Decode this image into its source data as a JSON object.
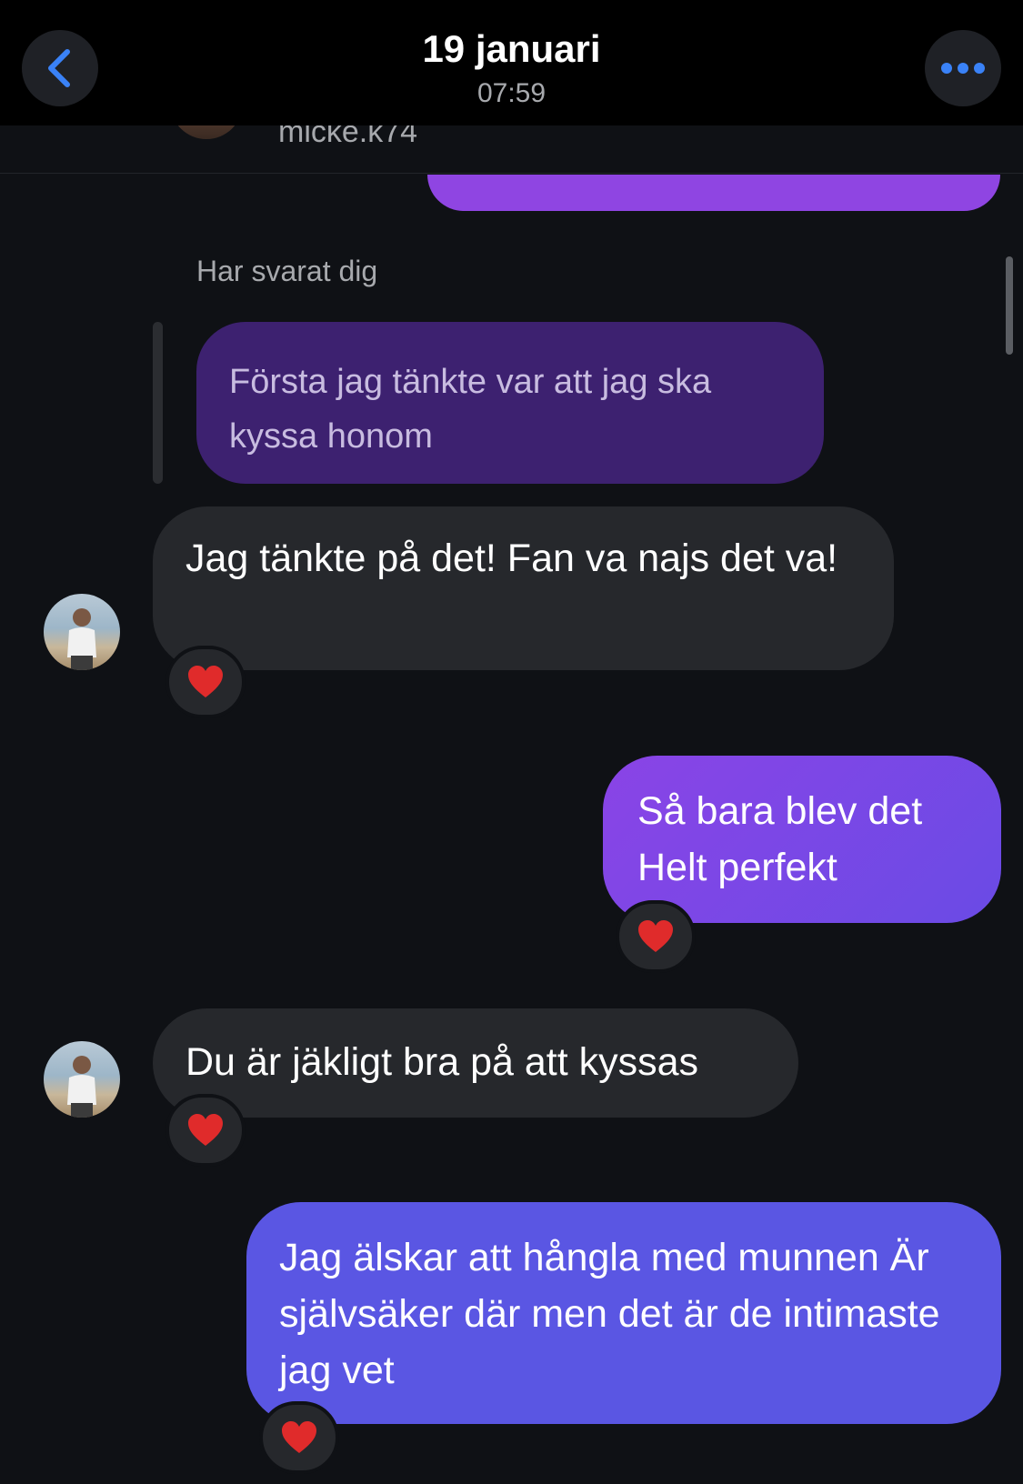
{
  "header": {
    "title": "19 januari",
    "time": "07:59"
  },
  "peek": {
    "username": "micke.k74"
  },
  "reply_label": "Har svarat dig",
  "quoted_message": "Första jag tänkte var att jag ska kyssa honom",
  "messages": [
    {
      "direction": "incoming",
      "text": "Jag tänkte på det! Fan va najs det va!",
      "reaction": "heart"
    },
    {
      "direction": "outgoing",
      "text": "Så bara blev det Helt perfekt",
      "reaction": "heart"
    },
    {
      "direction": "incoming",
      "text": "Du är jäkligt bra på att kyssas",
      "reaction": "heart"
    },
    {
      "direction": "outgoing",
      "text": "Jag älskar att hångla med munnen Är självsäker där men det är de intimaste jag vet",
      "reaction": "heart"
    }
  ],
  "colors": {
    "background": "#0f1115",
    "incoming_bubble": "#26282c",
    "outgoing_gradient_start": "#8a44e6",
    "outgoing_gradient_end": "#5a56e3",
    "quoted_bubble": "#3d2170",
    "accent_blue": "#3a82f7"
  },
  "icons": {
    "back": "chevron-left-icon",
    "more": "more-horizontal-icon",
    "reaction": "heart-icon"
  }
}
